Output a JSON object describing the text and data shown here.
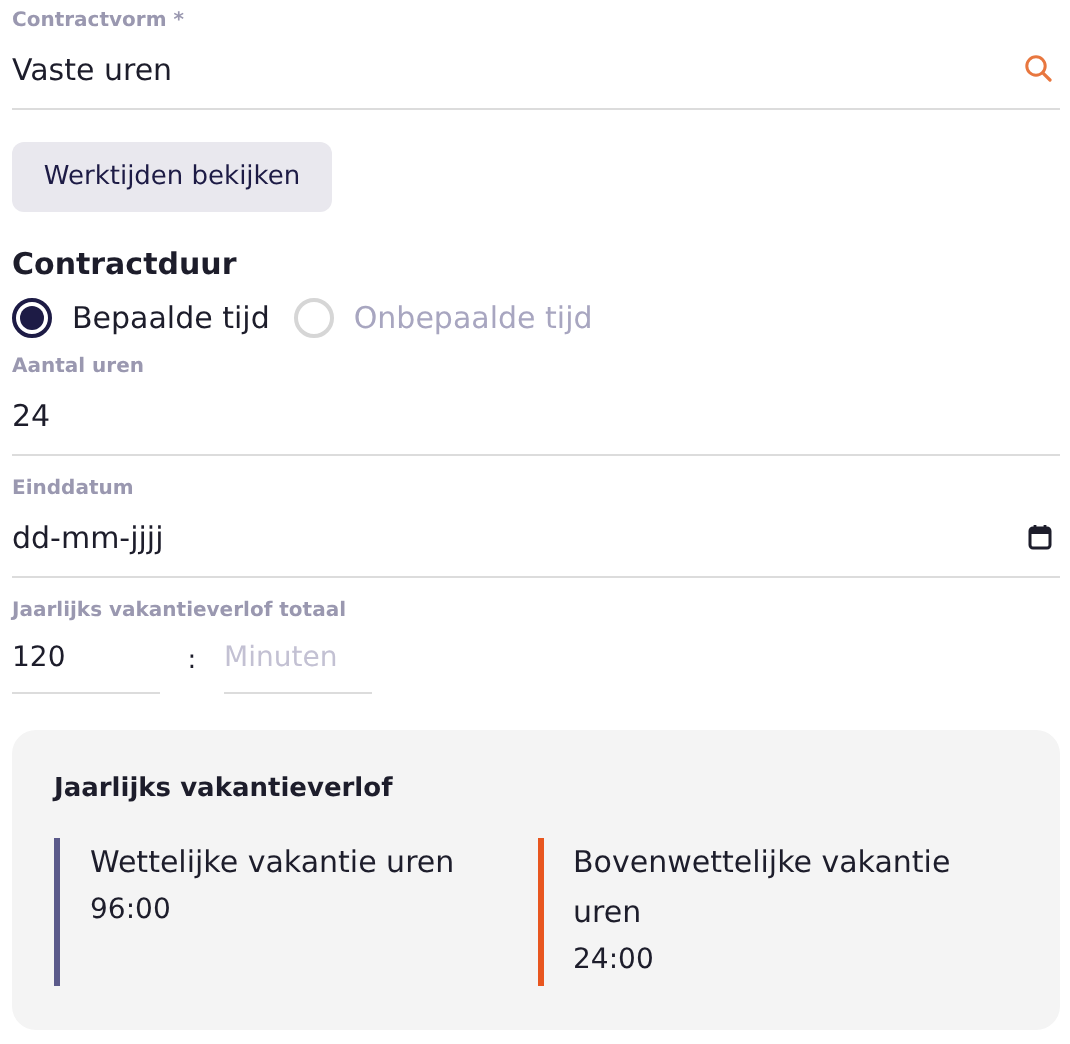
{
  "contract_form": {
    "label": "Contractvorm *",
    "value": "Vaste uren"
  },
  "view_button": {
    "label": "Werktijden bekijken"
  },
  "contract_duration": {
    "title": "Contractduur",
    "options": [
      {
        "label": "Bepaalde tijd",
        "selected": true
      },
      {
        "label": "Onbepaalde tijd",
        "selected": false
      }
    ]
  },
  "hours": {
    "label": "Aantal uren",
    "value": "24"
  },
  "end_date": {
    "label": "Einddatum",
    "placeholder": "dd-mm-jjjj"
  },
  "annual_leave_total": {
    "label": "Jaarlijks vakantieverlof totaal",
    "hours": "120",
    "separator": ":",
    "minutes_placeholder": "Minuten"
  },
  "leave_card": {
    "title": "Jaarlijks vakantieverlof",
    "items": [
      {
        "title": "Wettelijke vakantie uren",
        "value": "96:00",
        "color": "#5b5a8a"
      },
      {
        "title": "Bovenwettelijke vakantie uren",
        "value": "24:00",
        "color": "#e8561f"
      }
    ]
  }
}
